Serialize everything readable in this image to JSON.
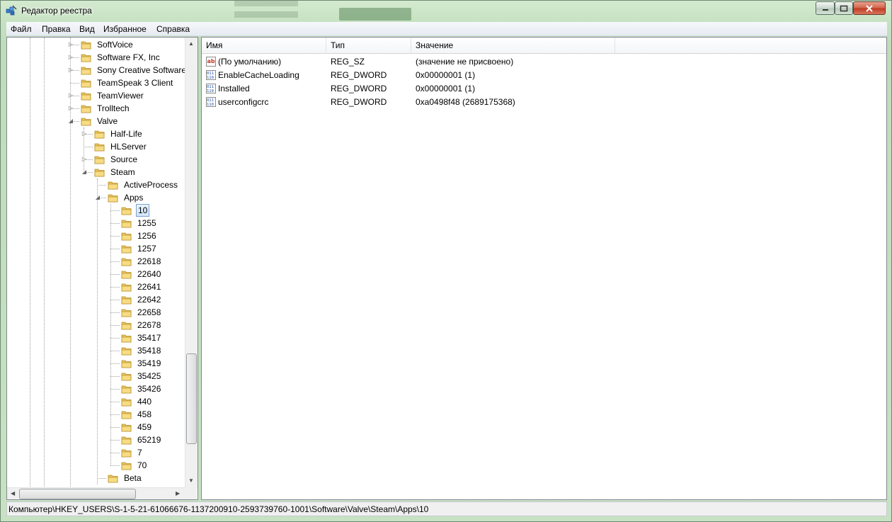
{
  "window": {
    "title": "Редактор реестра"
  },
  "menu": [
    "Файл",
    "Правка",
    "Вид",
    "Избранное",
    "Справка"
  ],
  "tree": [
    {
      "label": "SoftVoice",
      "level": 0,
      "exp": "closed"
    },
    {
      "label": "Software FX, Inc",
      "level": 0,
      "exp": "closed"
    },
    {
      "label": "Sony Creative Software",
      "level": 0,
      "exp": "closed"
    },
    {
      "label": "TeamSpeak 3 Client",
      "level": 0,
      "exp": "none"
    },
    {
      "label": "TeamViewer",
      "level": 0,
      "exp": "closed"
    },
    {
      "label": "Trolltech",
      "level": 0,
      "exp": "closed"
    },
    {
      "label": "Valve",
      "level": 0,
      "exp": "open"
    },
    {
      "label": "Half-Life",
      "level": 1,
      "exp": "closed"
    },
    {
      "label": "HLServer",
      "level": 1,
      "exp": "none"
    },
    {
      "label": "Source",
      "level": 1,
      "exp": "closed"
    },
    {
      "label": "Steam",
      "level": 1,
      "exp": "open"
    },
    {
      "label": "ActiveProcess",
      "level": 2,
      "exp": "none"
    },
    {
      "label": "Apps",
      "level": 2,
      "exp": "open"
    },
    {
      "label": "10",
      "level": 3,
      "exp": "none",
      "selected": true
    },
    {
      "label": "1255",
      "level": 3,
      "exp": "none"
    },
    {
      "label": "1256",
      "level": 3,
      "exp": "none"
    },
    {
      "label": "1257",
      "level": 3,
      "exp": "none"
    },
    {
      "label": "22618",
      "level": 3,
      "exp": "none"
    },
    {
      "label": "22640",
      "level": 3,
      "exp": "none"
    },
    {
      "label": "22641",
      "level": 3,
      "exp": "none"
    },
    {
      "label": "22642",
      "level": 3,
      "exp": "none"
    },
    {
      "label": "22658",
      "level": 3,
      "exp": "none"
    },
    {
      "label": "22678",
      "level": 3,
      "exp": "none"
    },
    {
      "label": "35417",
      "level": 3,
      "exp": "none"
    },
    {
      "label": "35418",
      "level": 3,
      "exp": "none"
    },
    {
      "label": "35419",
      "level": 3,
      "exp": "none"
    },
    {
      "label": "35425",
      "level": 3,
      "exp": "none"
    },
    {
      "label": "35426",
      "level": 3,
      "exp": "none"
    },
    {
      "label": "440",
      "level": 3,
      "exp": "none"
    },
    {
      "label": "458",
      "level": 3,
      "exp": "none"
    },
    {
      "label": "459",
      "level": 3,
      "exp": "none"
    },
    {
      "label": "65219",
      "level": 3,
      "exp": "none"
    },
    {
      "label": "7",
      "level": 3,
      "exp": "none"
    },
    {
      "label": "70",
      "level": 3,
      "exp": "none"
    },
    {
      "label": "Beta",
      "level": 2,
      "exp": "none"
    }
  ],
  "list": {
    "columns": [
      "Имя",
      "Тип",
      "Значение"
    ],
    "rows": [
      {
        "name": "(По умолчанию)",
        "type": "REG_SZ",
        "value": "(значение не присвоено)",
        "icon": "string-value-icon"
      },
      {
        "name": "EnableCacheLoading",
        "type": "REG_DWORD",
        "value": "0x00000001 (1)",
        "icon": "binary-value-icon"
      },
      {
        "name": "Installed",
        "type": "REG_DWORD",
        "value": "0x00000001 (1)",
        "icon": "binary-value-icon"
      },
      {
        "name": "userconfigcrc",
        "type": "REG_DWORD",
        "value": "0xa0498f48 (2689175368)",
        "icon": "binary-value-icon"
      }
    ]
  },
  "status": {
    "path": "Компьютер\\HKEY_USERS\\S-1-5-21-61066676-1137200910-2593739760-1001\\Software\\Valve\\Steam\\Apps\\10"
  },
  "colors": {
    "selection": "#d2e6fb",
    "selection_border": "#7da2ce",
    "folder": "#e9c35a"
  }
}
